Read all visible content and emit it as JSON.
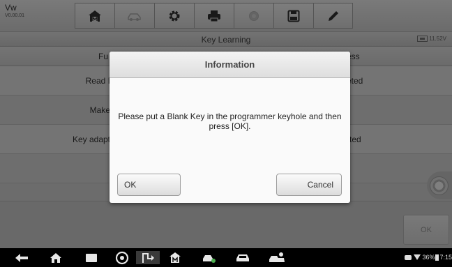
{
  "app": {
    "name": "Vw",
    "version": "V0.00.01"
  },
  "toolbar": {
    "tools": [
      {
        "icon": "home-icon",
        "enabled": true
      },
      {
        "icon": "vehicle-swap-icon",
        "enabled": false
      },
      {
        "icon": "settings-gear-icon",
        "enabled": true
      },
      {
        "icon": "print-icon",
        "enabled": true
      },
      {
        "icon": "help-icon",
        "enabled": false
      },
      {
        "icon": "save-icon",
        "enabled": true
      },
      {
        "icon": "edit-pen-icon",
        "enabled": true
      }
    ]
  },
  "titlebar": {
    "title": "Key Learning",
    "battery_voltage": "11.52V"
  },
  "table": {
    "header": {
      "col1": "Fu",
      "col2": "ess"
    },
    "rows": [
      {
        "col1": "Read I",
        "col2": "eted"
      },
      {
        "col1": "Make",
        "col2": ""
      },
      {
        "col1": "Key adapt",
        "col2": "rted"
      },
      {
        "col1": "",
        "col2": ""
      }
    ]
  },
  "bottom": {
    "ok_label": "OK"
  },
  "dialog": {
    "title": "Information",
    "message": "Please put a Blank Key in the programmer keyhole and then press [OK].",
    "ok_label": "OK",
    "cancel_label": "Cancel"
  },
  "statusbar": {
    "battery": "36%",
    "time": "7:15"
  },
  "colors": {
    "toolbar": "#e8e8e8",
    "dialog": "#fafafa",
    "navbar": "#000000"
  }
}
